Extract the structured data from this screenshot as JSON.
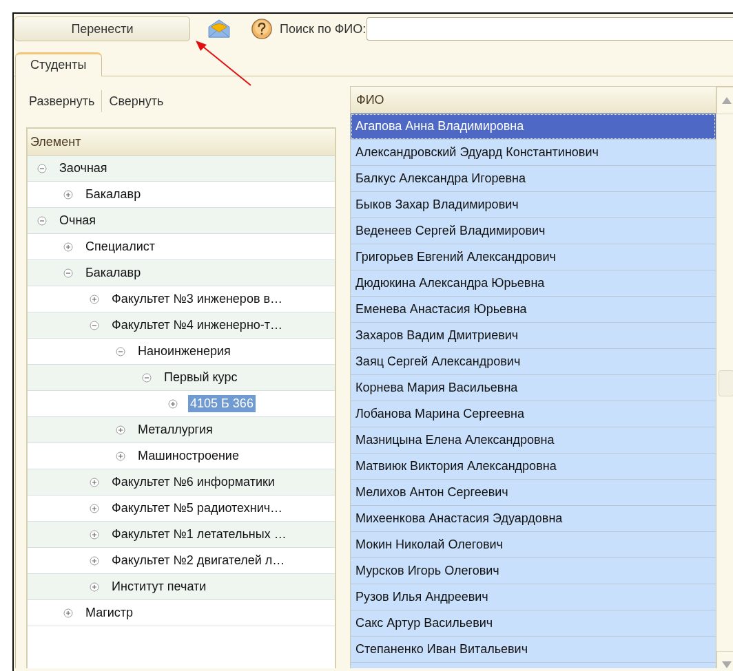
{
  "toolbar": {
    "move_button": "Перенести",
    "search": {
      "label": "Поиск по ФИО:"
    }
  },
  "annotations": [
    {
      "kind": "arrow",
      "color": "#e01010"
    }
  ],
  "tabs": [
    {
      "label": "Студенты",
      "selected": true
    }
  ],
  "tree_actions": [
    "Развернуть",
    "Свернуть"
  ],
  "tree": {
    "column": "Элемент",
    "items": [
      {
        "label": "Заочная",
        "expanded": true,
        "selected": false,
        "children": [
          {
            "label": "Бакалавр",
            "expanded": false,
            "selected": false
          }
        ]
      },
      {
        "label": "Очная",
        "expanded": true,
        "selected": false,
        "children": [
          {
            "label": "Специалист",
            "expanded": false,
            "selected": false
          },
          {
            "label": "Бакалавр",
            "expanded": true,
            "selected": false,
            "children": [
              {
                "label": "Факультет №3 инженеров в…",
                "expanded": false,
                "selected": false
              },
              {
                "label": "Факультет №4 инженерно-т…",
                "expanded": true,
                "selected": false,
                "children": [
                  {
                    "label": "Наноинженерия",
                    "expanded": true,
                    "selected": false,
                    "children": [
                      {
                        "label": "Первый курс",
                        "expanded": true,
                        "selected": false,
                        "children": [
                          {
                            "label": "4105 Б 366",
                            "expanded": false,
                            "selected": true
                          }
                        ]
                      }
                    ]
                  },
                  {
                    "label": "Металлургия",
                    "expanded": false,
                    "selected": false
                  },
                  {
                    "label": "Машиностроение",
                    "expanded": false,
                    "selected": false
                  }
                ]
              },
              {
                "label": "Факультет №6 информатики",
                "expanded": false,
                "selected": false
              },
              {
                "label": "Факультет №5 радиотехнич…",
                "expanded": false,
                "selected": false
              },
              {
                "label": "Факультет №1 летательных …",
                "expanded": false,
                "selected": false
              },
              {
                "label": "Факультет №2 двигателей л…",
                "expanded": false,
                "selected": false
              },
              {
                "label": "Институт печати",
                "expanded": false,
                "selected": false
              }
            ]
          },
          {
            "label": "Магистр",
            "expanded": false,
            "selected": false
          }
        ]
      }
    ]
  },
  "students": {
    "column": "ФИО",
    "rows": [
      {
        "name": "Агапова Анна Владимировна",
        "selected": true,
        "current": true
      },
      {
        "name": "Александровский Эдуард Константинович",
        "selected": true,
        "current": false
      },
      {
        "name": "Балкус Александра Игоревна",
        "selected": true,
        "current": false
      },
      {
        "name": "Быков Захар Владимирович",
        "selected": true,
        "current": false
      },
      {
        "name": "Веденеев Сергей Владимирович",
        "selected": true,
        "current": false
      },
      {
        "name": "Григорьев Евгений Александрович",
        "selected": true,
        "current": false
      },
      {
        "name": "Дюдюкина Александра Юрьевна",
        "selected": true,
        "current": false
      },
      {
        "name": "Еменева Анастасия Юрьевна",
        "selected": true,
        "current": false
      },
      {
        "name": "Захаров Вадим Дмитриевич",
        "selected": true,
        "current": false
      },
      {
        "name": "Заяц Сергей Александрович",
        "selected": true,
        "current": false
      },
      {
        "name": "Корнева Мария Васильевна",
        "selected": true,
        "current": false
      },
      {
        "name": "Лобанова Марина Сергеевна",
        "selected": true,
        "current": false
      },
      {
        "name": "Мазницына Елена Александровна",
        "selected": true,
        "current": false
      },
      {
        "name": "Матвиюк Виктория Александровна",
        "selected": true,
        "current": false
      },
      {
        "name": "Мелихов Антон Сергеевич",
        "selected": true,
        "current": false
      },
      {
        "name": "Михеенкова Анастасия Эдуардовна",
        "selected": true,
        "current": false
      },
      {
        "name": "Мокин Николай Олегович",
        "selected": true,
        "current": false
      },
      {
        "name": "Мурсков Игорь Олегович",
        "selected": true,
        "current": false
      },
      {
        "name": "Рузов Илья Андреевич",
        "selected": true,
        "current": false
      },
      {
        "name": "Сакс Артур Васильевич",
        "selected": true,
        "current": false
      },
      {
        "name": "Степаненко Иван Витальевич",
        "selected": true,
        "current": false
      }
    ]
  }
}
